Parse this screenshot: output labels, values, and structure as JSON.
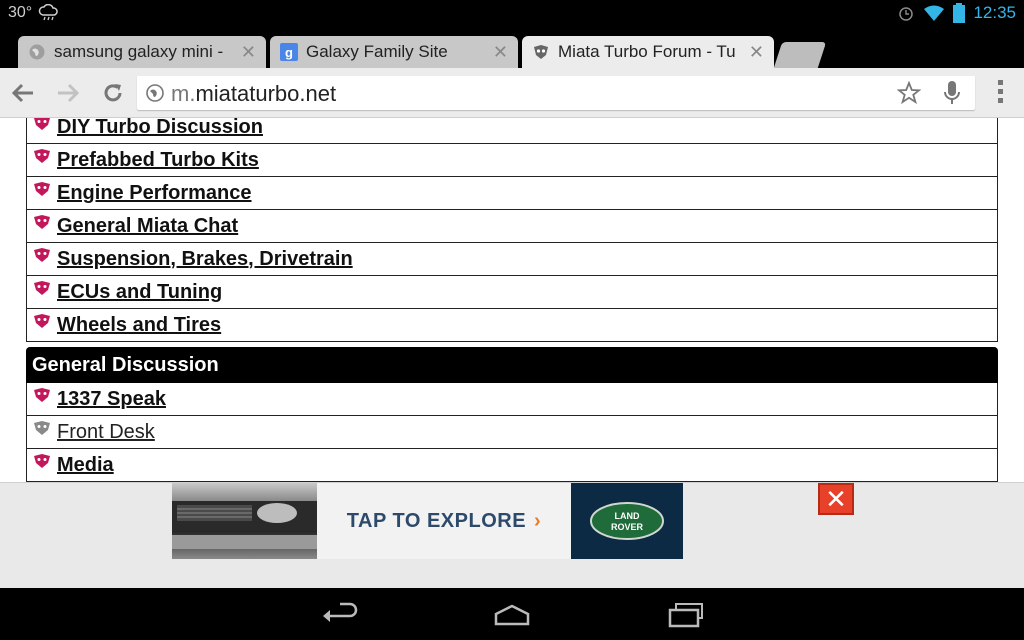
{
  "status_bar": {
    "temperature": "30°",
    "time": "12:35",
    "icons": [
      "cloud-rain-icon",
      "alarm-icon",
      "wifi-icon",
      "battery-icon"
    ]
  },
  "tabs": [
    {
      "title": "samsung galaxy mini -",
      "favicon": "globe-icon",
      "active": false
    },
    {
      "title": "Galaxy Family Site",
      "favicon": "google-icon",
      "active": false
    },
    {
      "title": "Miata Turbo Forum - Tu",
      "favicon": "forum-logo-icon",
      "active": true
    }
  ],
  "toolbar": {
    "url_scheme": "m.",
    "url_host": "miataturbo.net"
  },
  "forums_top": [
    {
      "label": "DIY Turbo Discussion",
      "bold": true
    },
    {
      "label": "Prefabbed Turbo Kits",
      "bold": true
    },
    {
      "label": "Engine Performance",
      "bold": true
    },
    {
      "label": "General Miata Chat",
      "bold": true
    },
    {
      "label": "Suspension, Brakes, Drivetrain",
      "bold": true
    },
    {
      "label": "ECUs and Tuning",
      "bold": true
    },
    {
      "label": "Wheels and Tires",
      "bold": true
    }
  ],
  "category": {
    "title": "General Discussion"
  },
  "forums_bottom": [
    {
      "label": "1337 Speak",
      "bold": true
    },
    {
      "label": "Front Desk",
      "bold": false
    },
    {
      "label": "Media",
      "bold": true
    }
  ],
  "ad": {
    "cta": "TAP TO EXPLORE",
    "arrow": "›",
    "close": "✕",
    "logo_text": "LAND ROVER"
  },
  "colors": {
    "accent": "#33b5e5",
    "forum_icon_new": "#c2185b",
    "forum_icon_old": "#8a8a8a",
    "ad_close": "#e8412a"
  }
}
